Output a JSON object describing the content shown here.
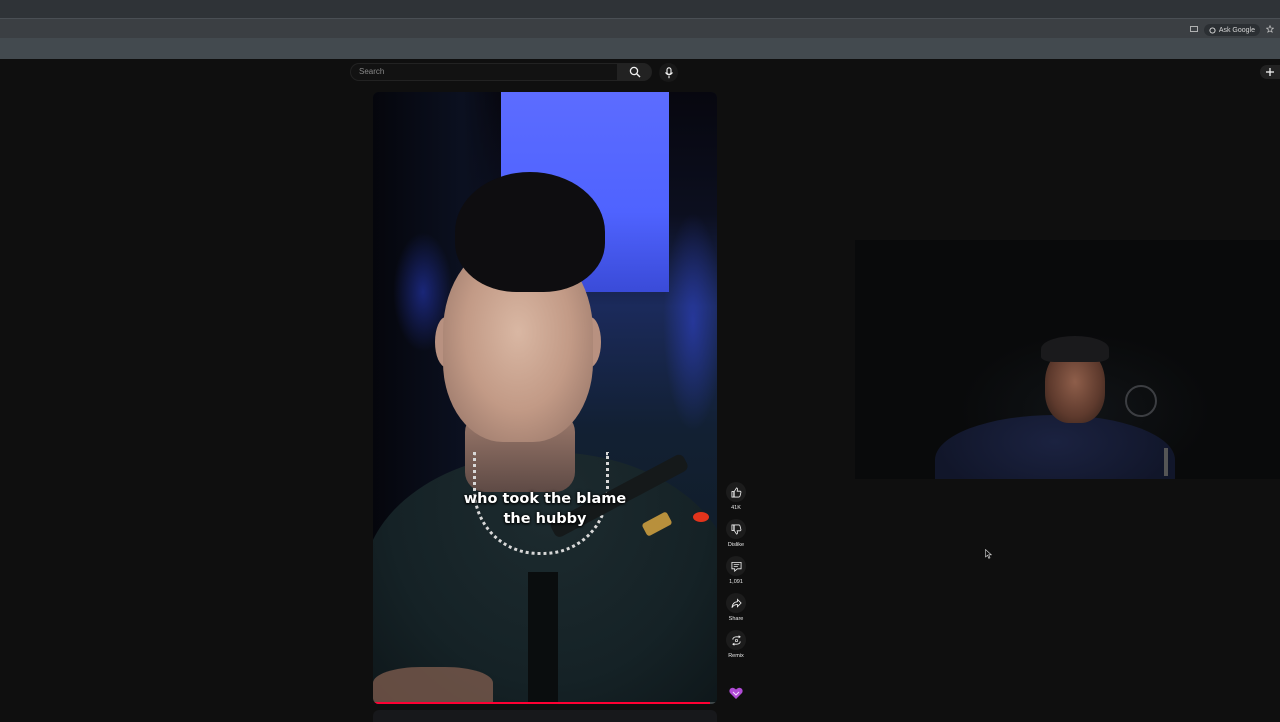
{
  "browser": {
    "ask_google_label": "Ask Google"
  },
  "search": {
    "placeholder": "Search"
  },
  "short": {
    "caption_line1": "who took the blame",
    "caption_line2": "the hubby",
    "progress_fraction": 0.98
  },
  "actions": {
    "like_count": "41K",
    "dislike_label": "Dislike",
    "comments_count": "1,091",
    "share_label": "Share",
    "remix_label": "Remix"
  },
  "colors": {
    "accent": "#ff0033",
    "page_bg": "#0f0f0f",
    "badge": "#b04bd6"
  },
  "icons": [
    "search-icon",
    "mic-icon",
    "create-icon",
    "like-icon",
    "dislike-icon",
    "comment-icon",
    "share-icon",
    "remix-icon",
    "channel-badge-icon",
    "cast-icon",
    "star-icon"
  ]
}
